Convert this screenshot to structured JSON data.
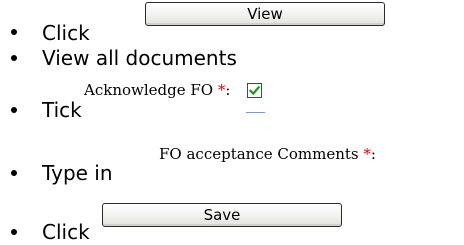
{
  "steps": [
    {
      "text": "Click",
      "button_label": "View"
    },
    {
      "text": "View all documents"
    },
    {
      "text": "Tick",
      "field_label": "Acknowledge FO",
      "required_marker": "*",
      "colon": ":",
      "checked": true
    },
    {
      "text": "Type in",
      "field_label": "FO acceptance Comments",
      "required_marker": "*",
      "colon": ":"
    },
    {
      "text": "Click",
      "button_label": "Save"
    }
  ],
  "colors": {
    "required_marker": "#e60000",
    "checkbox_tick": "#1b9a1b",
    "checkbox_border": "#1c5180"
  },
  "icons": {
    "bullet": "bullet-dot",
    "checkbox": "checkmark-icon"
  }
}
